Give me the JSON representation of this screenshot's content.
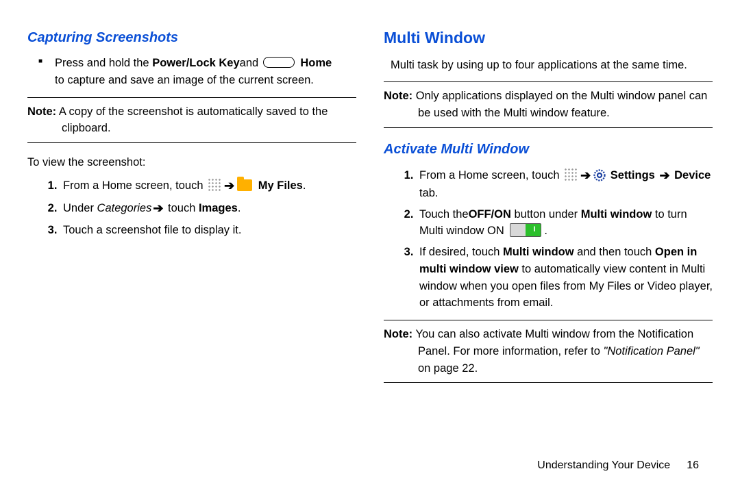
{
  "left": {
    "heading_sub": "Capturing Screenshots",
    "bullet_pre": "Press and hold the ",
    "bullet_b1": "Power/Lock Key",
    "bullet_mid1": "and ",
    "bullet_b2": " Home",
    "bullet_line2": "to capture and save an image of the current screen.",
    "note1_label": "Note:",
    "note1_text": " A copy of the screenshot is automatically saved to the clipboard.",
    "view_intro": "To view the screenshot:",
    "step1_pre": "From a Home screen, touch ",
    "step1_b": " My Files",
    "step1_end": ".",
    "step2_pre": "Under ",
    "step2_it": "Categories",
    "step2_mid": " touch ",
    "step2_b": "Images",
    "step2_end": ".",
    "step3": "Touch a screenshot file to display it."
  },
  "right": {
    "heading_main": "Multi Window",
    "intro": "Multi task by using up to four applications at the same time.",
    "note1_label": "Note:",
    "note1_text": " Only applications displayed on the Multi window panel can be used with the Multi window feature.",
    "heading_sub": "Activate Multi Window",
    "s1_pre": "From a Home screen, touch ",
    "s1_b1": " Settings ",
    "s1_b2": "Device",
    "s1_end": " tab.",
    "s2_pre": "Touch the",
    "s2_b1": "OFF/ON",
    "s2_mid": "  button under ",
    "s2_b2": "Multi window",
    "s2_post": " to turn Multi window ON ",
    "s2_end": ".",
    "s3_pre": "If desired, touch ",
    "s3_b1": "Multi window",
    "s3_mid1": " and then touch ",
    "s3_b2": "Open in multi window view",
    "s3_post": " to automatically view content in Multi window when you open files from My Files or Video player, or attachments from email.",
    "note2_label": "Note:",
    "note2_text_a": " You can also activate Multi window from the Notification Panel. For more information, refer to ",
    "note2_it": "\"Notification Panel\"",
    "note2_text_b": " on page 22."
  },
  "footer": {
    "section": "Understanding Your Device",
    "page": "16"
  }
}
